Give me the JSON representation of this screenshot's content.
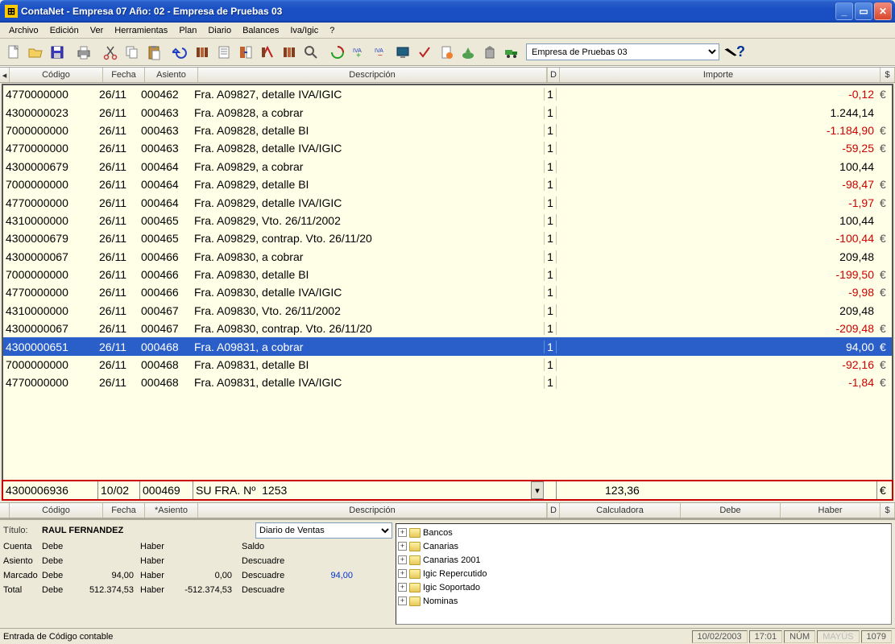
{
  "window": {
    "title": "ContaNet - Empresa 07  Año: 02 - Empresa de Pruebas 03"
  },
  "menu": [
    "Archivo",
    "Edición",
    "Ver",
    "Herramientas",
    "Plan",
    "Diario",
    "Balances",
    "Iva/Igic",
    "?"
  ],
  "company": "Empresa de Pruebas 03",
  "headers": {
    "codigo": "Código",
    "fecha": "Fecha",
    "asiento": "Asiento",
    "desc": "Descripción",
    "d": "D",
    "importe": "Importe",
    "eur": "$"
  },
  "footerLabels": {
    "codigo": "Código",
    "fecha": "Fecha",
    "asiento": "*Asiento",
    "desc": "Descripción",
    "d": "D",
    "calc": "Calculadora",
    "debe": "Debe",
    "haber": "Haber",
    "eur": "$"
  },
  "rows": [
    {
      "codigo": "4770000000",
      "fecha": "26/11",
      "asiento": "000462",
      "desc": "Fra. A09827, detalle IVA/IGIC",
      "d": "1",
      "importe": "-0,12",
      "neg": true,
      "eur": "€"
    },
    {
      "codigo": "4300000023",
      "fecha": "26/11",
      "asiento": "000463",
      "desc": "Fra. A09828, a cobrar",
      "d": "1",
      "importe": "1.244,14",
      "neg": false,
      "eur": ""
    },
    {
      "codigo": "7000000000",
      "fecha": "26/11",
      "asiento": "000463",
      "desc": "Fra. A09828, detalle BI",
      "d": "1",
      "importe": "-1.184,90",
      "neg": true,
      "eur": "€"
    },
    {
      "codigo": "4770000000",
      "fecha": "26/11",
      "asiento": "000463",
      "desc": "Fra. A09828, detalle IVA/IGIC",
      "d": "1",
      "importe": "-59,25",
      "neg": true,
      "eur": "€"
    },
    {
      "codigo": "4300000679",
      "fecha": "26/11",
      "asiento": "000464",
      "desc": "Fra. A09829, a cobrar",
      "d": "1",
      "importe": "100,44",
      "neg": false,
      "eur": ""
    },
    {
      "codigo": "7000000000",
      "fecha": "26/11",
      "asiento": "000464",
      "desc": "Fra. A09829, detalle BI",
      "d": "1",
      "importe": "-98,47",
      "neg": true,
      "eur": "€"
    },
    {
      "codigo": "4770000000",
      "fecha": "26/11",
      "asiento": "000464",
      "desc": "Fra. A09829, detalle IVA/IGIC",
      "d": "1",
      "importe": "-1,97",
      "neg": true,
      "eur": "€"
    },
    {
      "codigo": "4310000000",
      "fecha": "26/11",
      "asiento": "000465",
      "desc": "Fra. A09829, Vto. 26/11/2002",
      "d": "1",
      "importe": "100,44",
      "neg": false,
      "eur": ""
    },
    {
      "codigo": "4300000679",
      "fecha": "26/11",
      "asiento": "000465",
      "desc": "Fra. A09829, contrap. Vto. 26/11/20",
      "d": "1",
      "importe": "-100,44",
      "neg": true,
      "eur": "€"
    },
    {
      "codigo": "4300000067",
      "fecha": "26/11",
      "asiento": "000466",
      "desc": "Fra. A09830, a cobrar",
      "d": "1",
      "importe": "209,48",
      "neg": false,
      "eur": ""
    },
    {
      "codigo": "7000000000",
      "fecha": "26/11",
      "asiento": "000466",
      "desc": "Fra. A09830, detalle BI",
      "d": "1",
      "importe": "-199,50",
      "neg": true,
      "eur": "€"
    },
    {
      "codigo": "4770000000",
      "fecha": "26/11",
      "asiento": "000466",
      "desc": "Fra. A09830, detalle IVA/IGIC",
      "d": "1",
      "importe": "-9,98",
      "neg": true,
      "eur": "€"
    },
    {
      "codigo": "4310000000",
      "fecha": "26/11",
      "asiento": "000467",
      "desc": "Fra. A09830, Vto. 26/11/2002",
      "d": "1",
      "importe": "209,48",
      "neg": false,
      "eur": ""
    },
    {
      "codigo": "4300000067",
      "fecha": "26/11",
      "asiento": "000467",
      "desc": "Fra. A09830, contrap. Vto. 26/11/20",
      "d": "1",
      "importe": "-209,48",
      "neg": true,
      "eur": "€"
    },
    {
      "codigo": "4300000651",
      "fecha": "26/11",
      "asiento": "000468",
      "desc": "Fra. A09831, a cobrar",
      "d": "1",
      "importe": "94,00",
      "neg": false,
      "eur": "€",
      "selected": true
    },
    {
      "codigo": "7000000000",
      "fecha": "26/11",
      "asiento": "000468",
      "desc": "Fra. A09831, detalle BI",
      "d": "1",
      "importe": "-92,16",
      "neg": true,
      "eur": "€"
    },
    {
      "codigo": "4770000000",
      "fecha": "26/11",
      "asiento": "000468",
      "desc": "Fra. A09831, detalle IVA/IGIC",
      "d": "1",
      "importe": "-1,84",
      "neg": true,
      "eur": "€"
    }
  ],
  "inputRow": {
    "codigo": "4300006936",
    "fecha": "10/02",
    "asiento": "000469",
    "desc": "SU FRA. Nº  1253",
    "importe": "123,36",
    "eur": "€"
  },
  "bottom": {
    "tituloLabel": "Título:",
    "titulo": "RAUL FERNANDEZ",
    "labels": {
      "cuenta": "Cuenta",
      "asiento": "Asiento",
      "marcado": "Marcado",
      "total": "Total",
      "debe": "Debe",
      "haber": "Haber",
      "saldo": "Saldo",
      "descuadre": "Descuadre"
    },
    "diario": "Diario de Ventas",
    "rows": [
      {
        "k": "Cuenta",
        "debe": "",
        "haber": "",
        "r": "Saldo",
        "rv": ""
      },
      {
        "k": "Asiento",
        "debe": "",
        "haber": "",
        "r": "Descuadre",
        "rv": ""
      },
      {
        "k": "Marcado",
        "debe": "94,00",
        "haber": "0,00",
        "r": "Descuadre",
        "rv": "94,00",
        "blue": true
      },
      {
        "k": "Total",
        "debe": "512.374,53",
        "haber": "-512.374,53",
        "r": "Descuadre",
        "rv": ""
      }
    ]
  },
  "tree": [
    "Bancos",
    "Canarias",
    "Canarias 2001",
    "Igic Repercutido",
    "Igic Soportado",
    "Nominas"
  ],
  "status": {
    "left": "Entrada de Código contable",
    "date": "10/02/2003",
    "time": "17:01",
    "num": "NÚM",
    "may": "MAYÚS",
    "count": "1079"
  }
}
